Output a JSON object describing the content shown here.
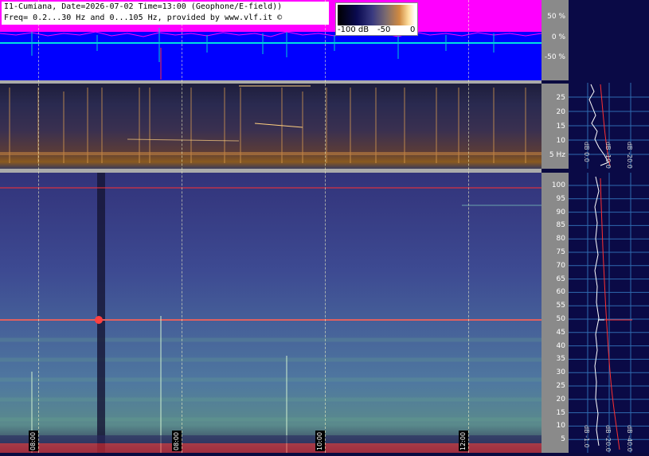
{
  "header": {
    "line1": "I1-Cumiana, Date=2026-07-02 Time=13:00 (Geophone/E-field))",
    "line2": "Freq= 0.2...30 Hz and 0...105 Hz, provided by www.vlf.it ©"
  },
  "colorbar": {
    "labels": [
      "-100 dB",
      "-50",
      "0"
    ]
  },
  "top_axis": {
    "ticks": [
      "50 %",
      "0 %",
      "-50 %"
    ]
  },
  "mid_axis": {
    "ticks": [
      "25",
      "20",
      "15",
      "10",
      "5 Hz"
    ]
  },
  "bottom_axis": {
    "ticks": [
      "100",
      "95",
      "90",
      "85",
      "80",
      "75",
      "70",
      "65",
      "60",
      "55",
      "50",
      "45",
      "40",
      "35",
      "30",
      "25",
      "20",
      "15",
      "10",
      "5"
    ]
  },
  "time_labels": [
    "08:00",
    "08:00",
    "10:00",
    "12:00"
  ],
  "side_panel_top": {
    "labels": [
      "dB 0.0",
      "dB -10.0",
      "dB -20.0"
    ]
  },
  "side_panel_bottom": {
    "labels": [
      "dB -1.0",
      "dB -20.0",
      "dB -40.0"
    ]
  },
  "colors": {
    "blue": "#0000ff",
    "magenta": "#ff00ff",
    "cyan": "#00e0e0",
    "red": "#ff3030",
    "navy": "#0a0a46"
  }
}
